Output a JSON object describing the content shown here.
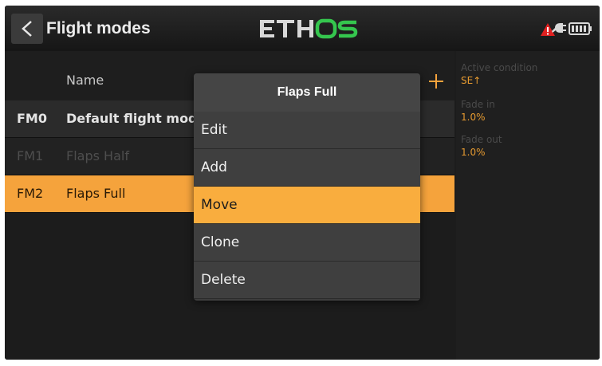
{
  "header": {
    "title": "Flight modes",
    "logo_text": "ETHOS",
    "colors": {
      "logo_main": "#d8d8d8",
      "logo_accent": "#35c64e",
      "warning": "#e02020"
    }
  },
  "list": {
    "column_name": "Name",
    "rows": [
      {
        "index": "FM0",
        "name": "Default flight mode"
      },
      {
        "index": "FM1",
        "name": "Flaps Half"
      },
      {
        "index": "FM2",
        "name": "Flaps Full"
      }
    ]
  },
  "info": {
    "active_condition_label": "Active condition",
    "active_condition_value": "SE↑",
    "fade_in_label": "Fade in",
    "fade_in_value": "1.0%",
    "fade_out_label": "Fade out",
    "fade_out_value": "1.0%"
  },
  "menu": {
    "title": "Flaps Full",
    "items": [
      {
        "label": "Edit"
      },
      {
        "label": "Add"
      },
      {
        "label": "Move"
      },
      {
        "label": "Clone"
      },
      {
        "label": "Delete"
      }
    ],
    "selected_label": "Move"
  },
  "accent_color": "#f9ad3e"
}
